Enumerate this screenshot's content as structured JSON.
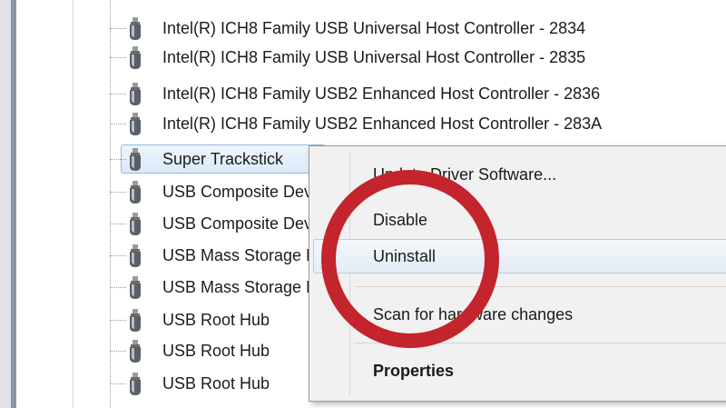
{
  "device_tree": {
    "items": [
      {
        "label": "Intel(R) ICH8 Family USB Universal Host Controller - 2834"
      },
      {
        "label": "Intel(R) ICH8 Family USB Universal Host Controller - 2835"
      },
      {
        "label": "Intel(R) ICH8 Family USB2 Enhanced Host Controller - 2836"
      },
      {
        "label": "Intel(R) ICH8 Family USB2 Enhanced Host Controller - 283A"
      },
      {
        "label": "Super Trackstick",
        "selected": true
      },
      {
        "label": "USB Composite Device"
      },
      {
        "label": "USB Composite Device"
      },
      {
        "label": "USB Mass Storage Device"
      },
      {
        "label": "USB Mass Storage Device"
      },
      {
        "label": "USB Root Hub"
      },
      {
        "label": "USB Root Hub"
      },
      {
        "label": "USB Root Hub"
      }
    ]
  },
  "context_menu": {
    "items": [
      {
        "label": "Update Driver Software..."
      },
      {
        "label": "Disable"
      },
      {
        "label": "Uninstall",
        "hovered": true
      },
      {
        "label": "Scan for hardware changes"
      },
      {
        "label": "Properties",
        "bold": true
      }
    ]
  },
  "annotation": {
    "circle_color": "#c4242b",
    "highlighted_item": "Uninstall"
  },
  "colors": {
    "selection_bg": "#dbe9f8",
    "selection_border": "#93b9e2",
    "menu_bg": "#f1f1f1"
  },
  "icons": {
    "device": "usb-device-icon"
  }
}
